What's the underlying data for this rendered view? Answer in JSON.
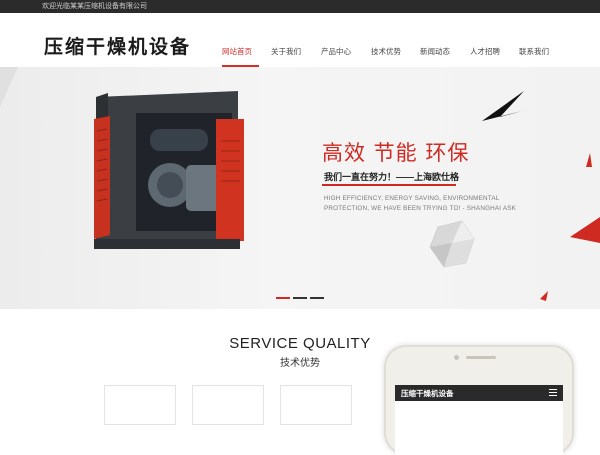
{
  "topbar": {
    "welcome": "欢迎光临某某压缩机设备有限公司"
  },
  "header": {
    "logo": "压缩干燥机设备"
  },
  "nav": {
    "items": [
      {
        "label": "网站首页",
        "active": true
      },
      {
        "label": "关于我们"
      },
      {
        "label": "产品中心"
      },
      {
        "label": "技术优势"
      },
      {
        "label": "新闻动态"
      },
      {
        "label": "人才招聘"
      },
      {
        "label": "联系我们"
      }
    ]
  },
  "banner": {
    "headline": "高效 节能 环保",
    "subline": "我们一直在努力！——上海欧仕格",
    "english": "HIGH EFFICIENCY, ENERGY SAVING, ENVIRONMENTAL PROTECTION, WE HAVE BEEN TRYING TO! - SHANGHAI ASK",
    "slides": 3,
    "active_slide": 0
  },
  "service": {
    "title": "SERVICE QUALITY",
    "subtitle": "技术优势"
  },
  "phone": {
    "screen_title": "压缩干燥机设备",
    "menu_icon": "menu-icon"
  },
  "colors": {
    "accent": "#cf2a22",
    "topbar": "#2b2b2b"
  }
}
